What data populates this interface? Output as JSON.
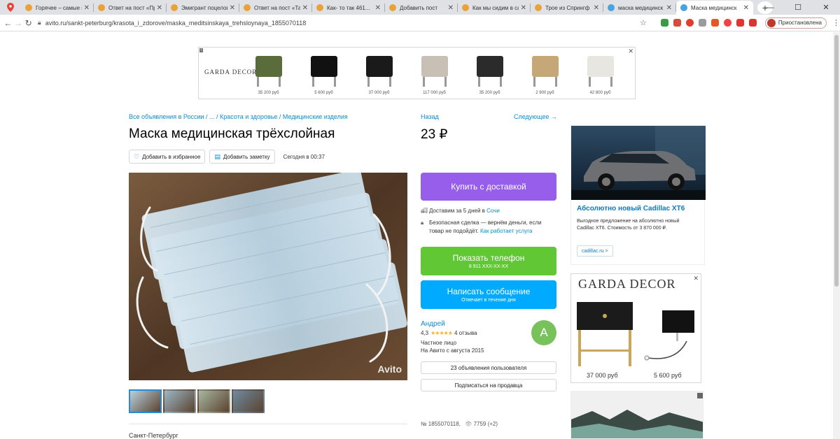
{
  "browser": {
    "tabs": [
      {
        "title": "Горячее – самые и",
        "color": "#e8a23c"
      },
      {
        "title": "Ответ на пост «Пр",
        "color": "#e8a23c"
      },
      {
        "title": "Эмигрант поцелов",
        "color": "#e8a23c"
      },
      {
        "title": "Ответ на пост «Та",
        "color": "#e8a23c"
      },
      {
        "title": "Как- то так 461...",
        "color": "#e8a23c"
      },
      {
        "title": "Добавить пост",
        "color": "#e8a23c"
      },
      {
        "title": "Как мы сидим в са",
        "color": "#e8a23c"
      },
      {
        "title": "Трое из Спрингф",
        "color": "#e8a23c"
      },
      {
        "title": "маска медицинск",
        "color": "#4aa3df"
      },
      {
        "title": "Маска медицинск",
        "color": "#4aa3df"
      }
    ],
    "url": "avito.ru/sankt-peterburg/krasota_i_zdorove/maska_meditsinskaya_trehsloynaya_1855070118",
    "profile_label": "Приостановлена"
  },
  "top_ad": {
    "brand": "GARDA DECOR",
    "items": [
      {
        "price": "35 200 руб"
      },
      {
        "price": "5 600 руб"
      },
      {
        "price": "37 000 руб"
      },
      {
        "price": "117 000 руб"
      },
      {
        "price": "35 200 руб"
      },
      {
        "price": "2 900 руб"
      },
      {
        "price": "42 800 руб"
      }
    ]
  },
  "listing": {
    "breadcrumbs": "Все объявления в России / ... / Красота и здоровье / Медицинские изделия",
    "title": "Маска медицинская трёхслойная",
    "add_favorite": "Добавить в избранное",
    "add_note": "Добавить заметку",
    "posted": "Сегодня в 00:37",
    "watermark": "Avito",
    "city": "Санкт-Петербург",
    "thumbnail_count": 4
  },
  "side": {
    "back": "Назад",
    "next": "Следующее →",
    "price": "23 ₽",
    "buy_button": "Купить с доставкой",
    "delivery_text": "Доставим за 5 дней в ",
    "delivery_city": "Сочи",
    "safe_deal_text": "Безопасная сделка — вернём деньги, если товар не подойдёт.",
    "safe_deal_link": "Как работает услуга",
    "phone_button": "Показать телефон",
    "phone_number": "8 911 XXX-XX-XX",
    "message_button": "Написать сообщение",
    "message_sub": "Отвечает в течение дня",
    "seller_name": "Андрей",
    "rating": "4,3",
    "stars": "★★★★★",
    "reviews": "4 отзыва",
    "seller_type": "Частное лицо",
    "seller_since": "На Авито с августа 2015",
    "avatar_letter": "А",
    "user_ads_button": "23 объявления пользователя",
    "subscribe_button": "Подписаться на продавца",
    "ad_number": "№ 1855070118,",
    "views": "7759 (+2)"
  },
  "right_ads": {
    "cadillac_title": "Абсолютно новый Cadillac XT6",
    "cadillac_desc": "Выгодное предложение на абсолютно новый Cadillac XT6. Стоимость от 3 870 000 ₽.",
    "cadillac_link": "cadillac.ru >",
    "garda_brand": "GARDA DECOR",
    "garda_price_1": "37 000 руб",
    "garda_price_2": "5 600 руб"
  }
}
